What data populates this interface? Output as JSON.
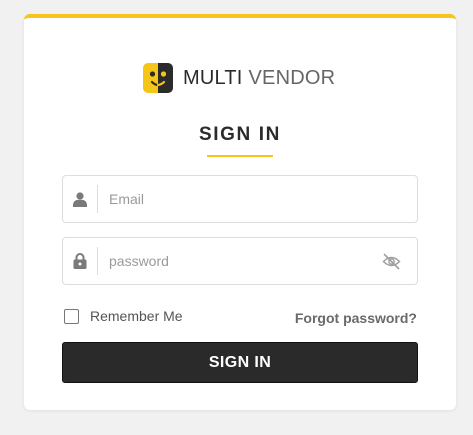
{
  "brand": {
    "word1": "MULTI",
    "word2": "VENDOR",
    "logo_icon": "smiley-face-icon",
    "accent_color": "#f5c518"
  },
  "login": {
    "title": "SIGN IN",
    "email_placeholder": "Email",
    "email_value": "",
    "email_icon": "user-icon",
    "password_placeholder": "password",
    "password_value": "",
    "password_icon": "lock-icon",
    "toggle_icon": "eye-slash-icon",
    "remember_label": "Remember Me",
    "remember_checked": false,
    "forgot_label": "Forgot password?",
    "submit_label": "SIGN IN"
  }
}
